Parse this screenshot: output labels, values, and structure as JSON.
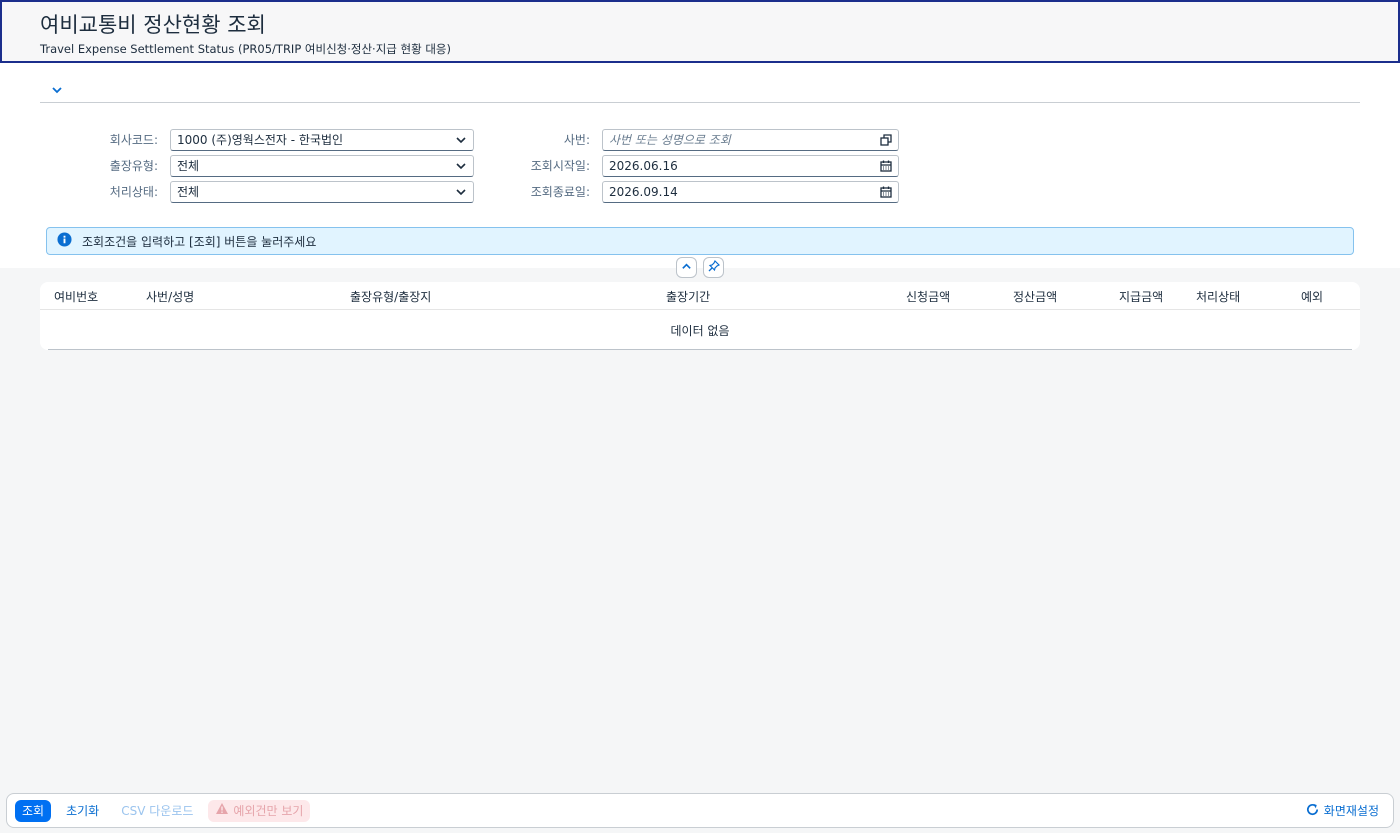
{
  "header": {
    "title": "여비교통비 정산현황 조회",
    "subtitle": "Travel Expense Settlement Status (PR05/TRIP 여비신청·정산·지급 현황 대응)"
  },
  "filters": {
    "company_label": "회사코드:",
    "company_value": "1000 (주)영웍스전자 - 한국법인",
    "trip_type_label": "출장유형:",
    "trip_type_value": "전체",
    "status_label": "처리상태:",
    "status_value": "전체",
    "employee_label": "사번:",
    "employee_placeholder": "사번 또는 성명으로 조회",
    "start_label": "조회시작일:",
    "start_value": "2026.06.16",
    "end_label": "조회종료일:",
    "end_value": "2026.09.14"
  },
  "info": {
    "message": "조회조건을 입력하고 [조회] 버튼을 눌러주세요"
  },
  "table": {
    "columns": [
      "여비번호",
      "사번/성명",
      "출장유형/출장지",
      "출장기간",
      "신청금액",
      "정산금액",
      "지급금액",
      "처리상태",
      "예외"
    ],
    "empty_text": "데이터 없음"
  },
  "footer": {
    "search_label": "조회",
    "reset_label": "초기화",
    "csv_label": "CSV 다운로드",
    "exceptions_label": "예외건만 보기",
    "layout_reset_label": "화면재설정"
  },
  "colors": {
    "accent": "#0070f2",
    "header_border": "#1b2e8c",
    "info_bg": "#e1f4ff"
  },
  "icons": [
    "chevron-down-icon",
    "value-help-icon",
    "calendar-icon",
    "info-icon",
    "chevron-up-icon",
    "pin-icon",
    "warning-icon",
    "refresh-icon"
  ]
}
